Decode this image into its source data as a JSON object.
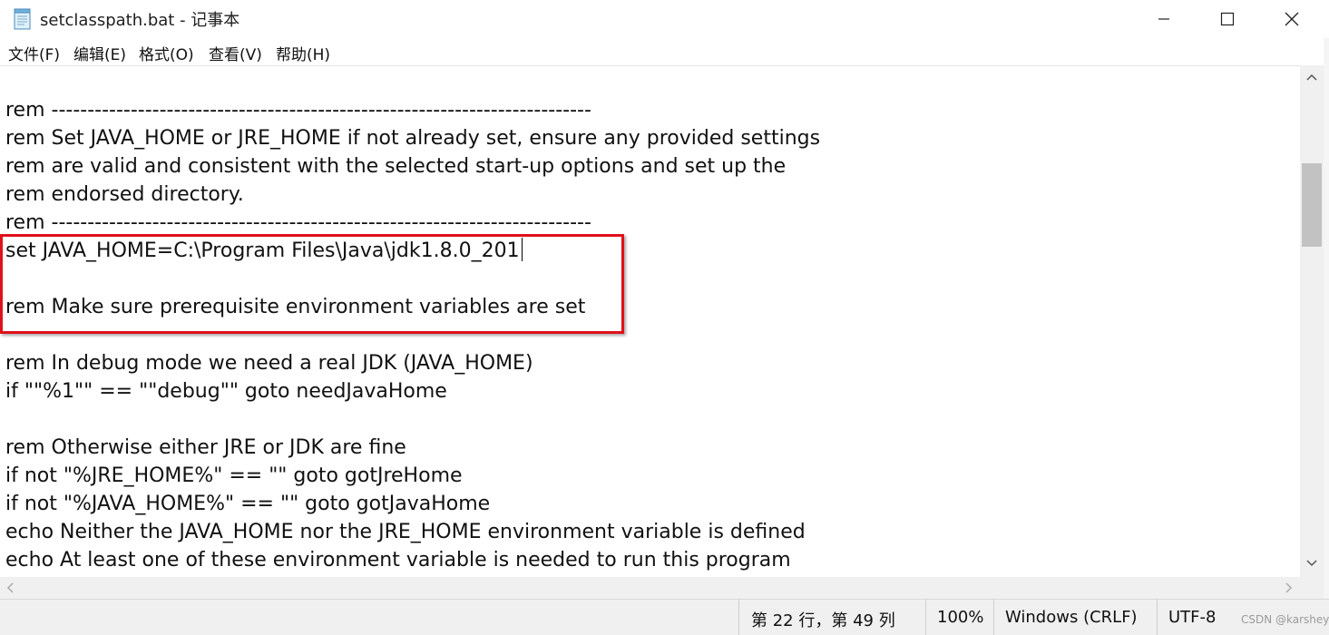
{
  "window": {
    "title": "setclasspath.bat - 记事本",
    "icon": "notepad-icon",
    "controls": [
      "minimize-icon",
      "maximize-icon",
      "close-icon"
    ]
  },
  "menu": {
    "items": [
      {
        "label": "文件(F)"
      },
      {
        "label": "编辑(E)"
      },
      {
        "label": "格式(O)"
      },
      {
        "label": "查看(V)"
      },
      {
        "label": "帮助(H)"
      }
    ]
  },
  "editor": {
    "lines": [
      "rem ---------------------------------------------------------------------------",
      "rem Set JAVA_HOME or JRE_HOME if not already set, ensure any provided settings",
      "rem are valid and consistent with the selected start-up options and set up the",
      "rem endorsed directory.",
      "rem ---------------------------------------------------------------------------",
      "set JAVA_HOME=C:\\Program Files\\Java\\jdk1.8.0_201",
      "",
      "rem Make sure prerequisite environment variables are set",
      "",
      "rem In debug mode we need a real JDK (JAVA_HOME)",
      "if \"\"%1\"\" == \"\"debug\"\" goto needJavaHome",
      "",
      "rem Otherwise either JRE or JDK are fine",
      "if not \"%JRE_HOME%\" == \"\" goto gotJreHome",
      "if not \"%JAVA_HOME%\" == \"\" goto gotJavaHome",
      "echo Neither the JAVA_HOME nor the JRE_HOME environment variable is defined",
      "echo At least one of these environment variable is needed to run this program"
    ],
    "highlight_color": "#e0101a"
  },
  "status": {
    "position": "第 22 行，第 49 列",
    "zoom": "100%",
    "line_ending": "Windows (CRLF)",
    "encoding": "UTF-8"
  },
  "watermark": "CSDN @karshey"
}
